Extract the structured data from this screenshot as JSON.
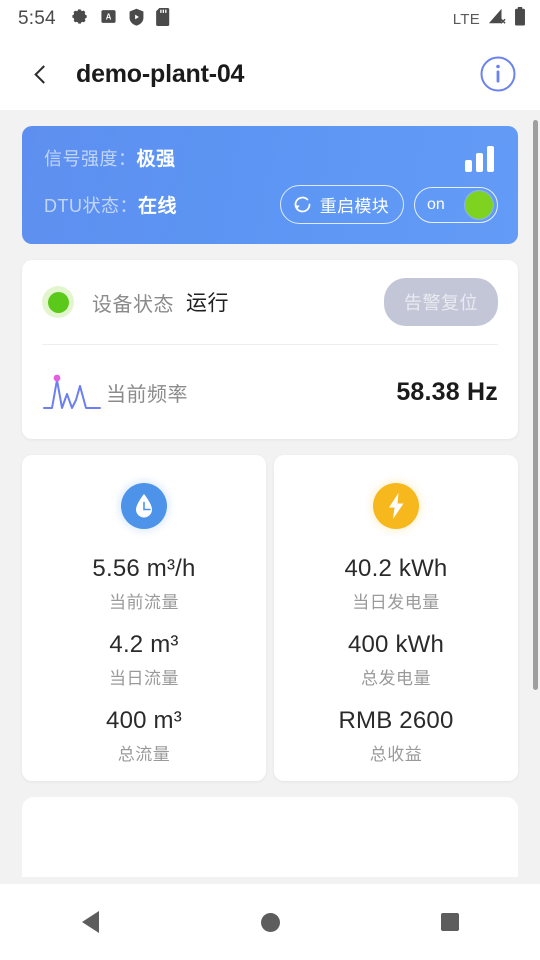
{
  "statusbar": {
    "time": "5:54",
    "left_icons": [
      "gear-icon",
      "boxed-a-icon",
      "shield-play-icon",
      "sd-card-icon"
    ],
    "network_label": "LTE",
    "right_icons": [
      "signal-no-service-icon",
      "battery-full-icon"
    ]
  },
  "header": {
    "back_icon": "chevron-left-icon",
    "title": "demo-plant-04",
    "info_icon": "info-circle-icon"
  },
  "dtu_card": {
    "signal_label": "信号强度：",
    "signal_value": "极强",
    "status_label": "DTU状态：",
    "status_value": "在线",
    "signal_icon": "signal-bars-icon",
    "restart_icon": "refresh-icon",
    "restart_label": "重启模块",
    "toggle_label": "on",
    "toggle_state": "on",
    "bg_color": "#5c92f1",
    "toggle_knob_color": "#7ed321"
  },
  "status_card": {
    "dot_icon": "status-dot-icon",
    "dot_color": "#5bc91a",
    "label": "设备状态",
    "value": "运行",
    "alarm_reset_label": "告警复位",
    "alarm_reset_color": "#c3c6d6",
    "freq_icon": "waveform-icon",
    "freq_label": "当前频率",
    "freq_value": "58.38 Hz"
  },
  "metrics": [
    {
      "icon": "water-drop-icon",
      "icon_color": "#4e93ea",
      "items": [
        {
          "value": "5.56 m³/h",
          "caption": "当前流量"
        },
        {
          "value": "4.2 m³",
          "caption": "当日流量"
        },
        {
          "value": "400 m³",
          "caption": "总流量"
        }
      ]
    },
    {
      "icon": "lightning-bolt-icon",
      "icon_color": "#f6b81d",
      "items": [
        {
          "value": "40.2 kWh",
          "caption": "当日发电量"
        },
        {
          "value": "400 kWh",
          "caption": "总发电量"
        },
        {
          "value": "RMB 2600",
          "caption": "总收益"
        }
      ]
    }
  ],
  "navbar": {
    "back_icon": "nav-back-icon",
    "home_icon": "nav-home-icon",
    "recent_icon": "nav-recents-icon"
  }
}
